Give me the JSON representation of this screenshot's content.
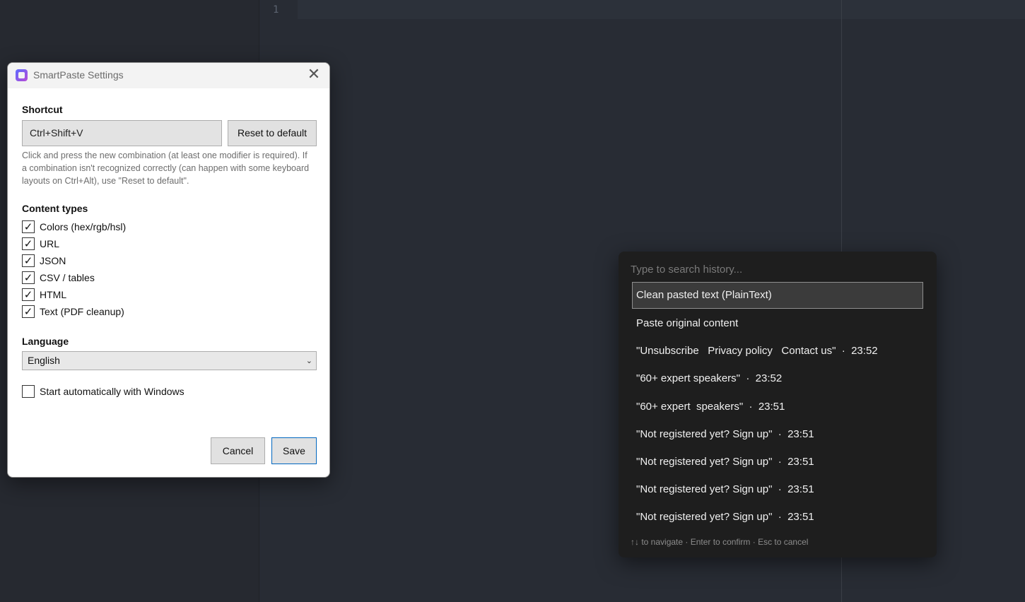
{
  "editor": {
    "line_number": "1"
  },
  "dialog": {
    "title": "SmartPaste Settings",
    "close_glyph": "✕",
    "shortcut": {
      "label": "Shortcut",
      "value": "Ctrl+Shift+V",
      "reset_label": "Reset to default",
      "hint": "Click and press the new combination (at least one modifier is required). If a combination isn't recognized correctly (can happen with some keyboard layouts on Ctrl+Alt), use \"Reset to default\"."
    },
    "content_types": {
      "label": "Content types",
      "items": [
        {
          "label": "Colors (hex/rgb/hsl)",
          "checked": true
        },
        {
          "label": "URL",
          "checked": true
        },
        {
          "label": "JSON",
          "checked": true
        },
        {
          "label": "CSV / tables",
          "checked": true
        },
        {
          "label": "HTML",
          "checked": true
        },
        {
          "label": "Text (PDF cleanup)",
          "checked": true
        }
      ]
    },
    "language": {
      "label": "Language",
      "value": "English"
    },
    "autostart": {
      "label": "Start automatically with Windows",
      "checked": false
    },
    "cancel_label": "Cancel",
    "save_label": "Save"
  },
  "popup": {
    "search_placeholder": "Type to search history...",
    "items": [
      "Clean pasted text (PlainText)",
      "Paste original content",
      "\"Unsubscribe   Privacy policy   Contact us\"  ·  23:52",
      "\"60+ expert speakers\"  ·  23:52",
      "\"60+ expert  speakers\"  ·  23:51",
      "\"Not registered yet? Sign up\"  ·  23:51",
      "\"Not registered yet? Sign up\"  ·  23:51",
      "\"Not registered yet? Sign up\"  ·  23:51",
      "\"Not registered yet? Sign up\"  ·  23:51"
    ],
    "footer": "↑↓ to navigate · Enter to confirm · Esc to cancel"
  }
}
